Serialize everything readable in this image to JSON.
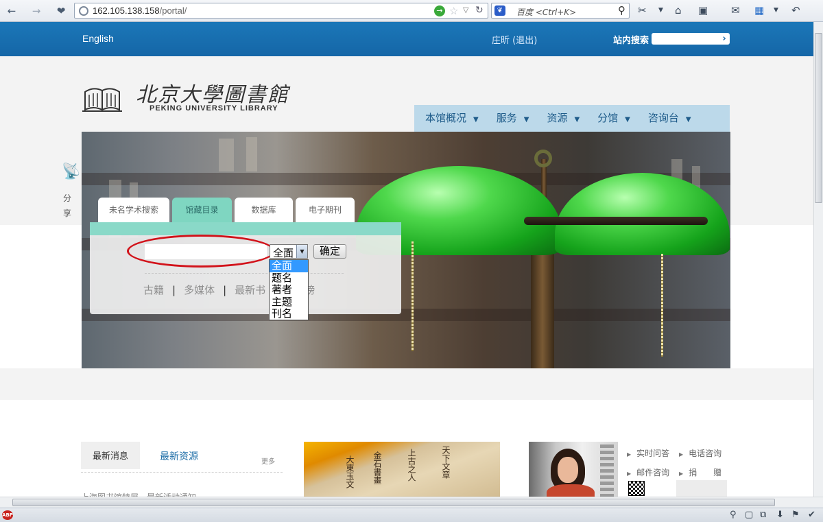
{
  "browser": {
    "url_host": "162.105.138.158",
    "url_path": "/portal/",
    "search_engine": "百度",
    "search_placeholder": "<Ctrl+K>"
  },
  "header": {
    "language_link": "English",
    "user": "庄昕 (退出)",
    "site_search_label": "站内搜索",
    "site_search_value": ""
  },
  "logo": {
    "cn": "北京大學圖書館",
    "en": "PEKING UNIVERSITY LIBRARY"
  },
  "main_nav": [
    {
      "label": "本馆概况"
    },
    {
      "label": "服务"
    },
    {
      "label": "资源"
    },
    {
      "label": "分馆"
    },
    {
      "label": "咨询台"
    }
  ],
  "share": {
    "label": "分享"
  },
  "search_tabs": [
    {
      "label": "未名学术搜索",
      "active": false
    },
    {
      "label": "馆藏目录",
      "active": true
    },
    {
      "label": "数据库",
      "active": false
    },
    {
      "label": "电子期刊",
      "active": false
    }
  ],
  "search_panel": {
    "query_value": "",
    "scope_selected": "全面",
    "submit_label": "确定",
    "scope_options": [
      "全面",
      "题名",
      "著者",
      "主题",
      "刊名"
    ],
    "quick_links": [
      "古籍",
      "多媒体",
      "最新书",
      "阅榜"
    ]
  },
  "news": {
    "tab_active": "最新消息",
    "tab_other": "最新资源",
    "more": "更多",
    "first_item": "上海图书馆特展…最新活动通知"
  },
  "services": [
    "实时问答",
    "电话咨询",
    "邮件咨询",
    "捐　　赠"
  ],
  "colors": {
    "banner_blue": "#1566a7",
    "nav_bg": "#bcd9ea",
    "tab_active": "#7fd6c1",
    "annotation_red": "#d2121a"
  }
}
